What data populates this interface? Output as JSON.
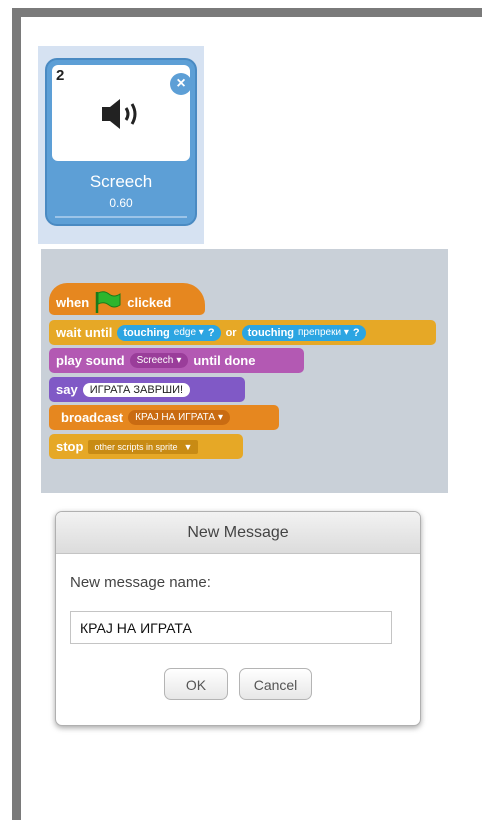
{
  "sound_tile": {
    "number": "2",
    "delete_glyph": "×",
    "name": "Screech",
    "duration": "0.60",
    "icon": "speaker-icon",
    "accent": "#5d9fd6"
  },
  "script": {
    "hat": {
      "when": "when",
      "clicked": "clicked",
      "icon": "green-flag-icon"
    },
    "wait": {
      "label": "wait until",
      "touching1": "touching",
      "target1": "edge",
      "q1": "?",
      "or": "or",
      "touching2": "touching",
      "target2": "препреки",
      "q2": "?"
    },
    "play": {
      "label1": "play sound",
      "sound": "Screech",
      "label2": "until done"
    },
    "say": {
      "label": "say",
      "text": "ИГРАТА ЗАВРШИ!"
    },
    "broadcast": {
      "label": "broadcast",
      "message": "КРАЈ НА ИГРАТА"
    },
    "stop": {
      "label": "stop",
      "option": "other scripts in sprite"
    },
    "colors": {
      "events": "#e6871f",
      "control": "#e6a826",
      "sound": "#b359b3",
      "looks": "#8059c6",
      "sensing": "#2ca5e2"
    }
  },
  "dialog": {
    "title": "New Message",
    "label": "New message name:",
    "input_value": "КРАЈ НА ИГРАТА",
    "ok": "OK",
    "cancel": "Cancel"
  }
}
